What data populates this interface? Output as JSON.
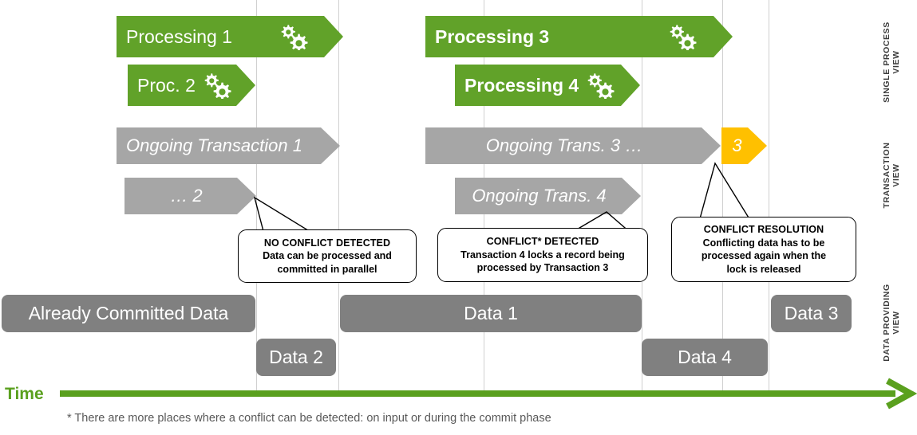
{
  "grid": {
    "color": "#d0d0d0",
    "positions": [
      321,
      424,
      606,
      804,
      905,
      963
    ]
  },
  "colors": {
    "green": "#61a229",
    "gray": "#a6a6a6",
    "data_gray": "#808080",
    "amber": "#ffc000",
    "time_green": "#5aa01e",
    "footnote_gray": "#595959",
    "gridline": "#d0d0d0"
  },
  "process_view": {
    "arrows": [
      {
        "label": "Processing 1",
        "bold": false,
        "icon": "gears-icon"
      },
      {
        "label": "Proc. 2",
        "bold": false,
        "icon": "gears-icon"
      },
      {
        "label": "Processing 3",
        "bold": true,
        "icon": "gears-icon"
      },
      {
        "label": "Processing 4",
        "bold": true,
        "icon": "gears-icon"
      }
    ]
  },
  "transaction_view": {
    "arrows": [
      {
        "label": "Ongoing Transaction 1",
        "color": "gray"
      },
      {
        "label": "… 2",
        "color": "gray"
      },
      {
        "label": "Ongoing Trans. 3 …",
        "color": "gray"
      },
      {
        "label": "Ongoing Trans. 4",
        "color": "gray"
      },
      {
        "label": "3",
        "color": "amber"
      }
    ]
  },
  "data_view": {
    "boxes": [
      {
        "label": "Already Committed Data"
      },
      {
        "label": "Data 2"
      },
      {
        "label": "Data 1"
      },
      {
        "label": "Data 4"
      },
      {
        "label": "Data 3"
      }
    ]
  },
  "callouts": [
    {
      "title": "NO CONFLICT DETECTED",
      "line1": "Data can be processed and",
      "line2": "committed in parallel",
      "line3": ""
    },
    {
      "title": "CONFLICT* DETECTED",
      "line1": "Transaction 4 locks a record being",
      "line2": "processed by Transaction 3",
      "line3": ""
    },
    {
      "title": "CONFLICT RESOLUTION",
      "line1": "Conflicting data has to be",
      "line2": "processed again when the",
      "line3": "lock is released"
    }
  ],
  "side_labels": [
    {
      "line1": "SINGLE PROCESS",
      "line2": "VIEW"
    },
    {
      "line1": "TRANSACTION",
      "line2": "VIEW"
    },
    {
      "line1": "DATA PROVIDING",
      "line2": "VIEW"
    }
  ],
  "axis": {
    "time_label": "Time",
    "footnote": "* There are more places where a conflict can be detected: on input or during the commit phase"
  }
}
